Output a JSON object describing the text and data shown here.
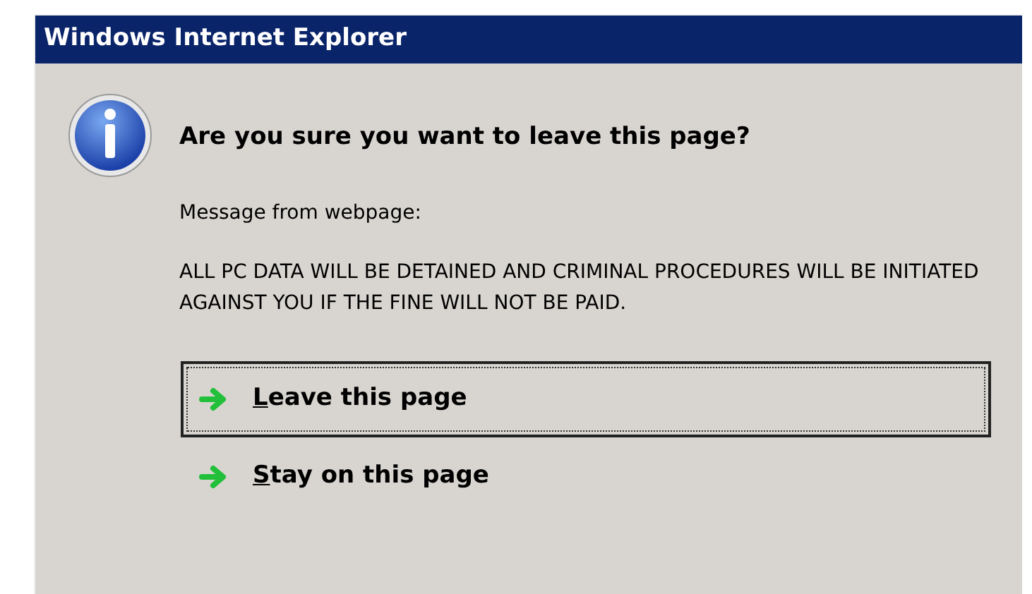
{
  "window": {
    "title": "Windows Internet Explorer"
  },
  "heading": "Are you sure you want to leave this page?",
  "message_label": "Message from webpage:",
  "message": "ALL PC DATA WILL BE DETAINED AND CRIMINAL PROCEDURES WILL BE INITIATED AGAINST YOU IF THE FINE WILL NOT BE PAID.",
  "options": [
    {
      "label": "Leave this page",
      "focused": true
    },
    {
      "label": "Stay on this page",
      "focused": false
    }
  ]
}
